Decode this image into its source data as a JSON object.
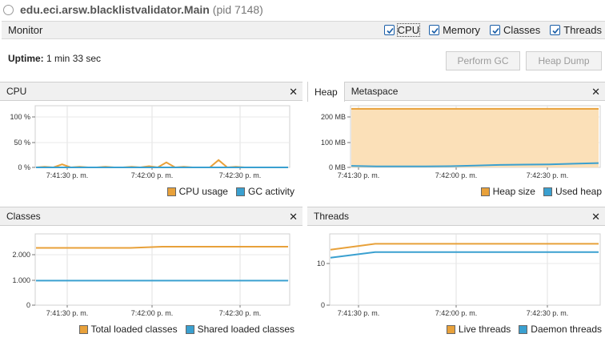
{
  "window": {
    "app_name": "edu.eci.arsw.blacklistvalidator.Main",
    "pid": "(pid 7148)"
  },
  "monitor": {
    "label": "Monitor",
    "checkboxes": [
      {
        "label": "CPU",
        "checked": true
      },
      {
        "label": "Memory",
        "checked": true
      },
      {
        "label": "Classes",
        "checked": true
      },
      {
        "label": "Threads",
        "checked": true
      }
    ]
  },
  "uptime": {
    "label": "Uptime:",
    "value": "1 min 33 sec"
  },
  "buttons": {
    "perform_gc": "Perform GC",
    "heap_dump": "Heap Dump"
  },
  "colors": {
    "orange": "#e8a13a",
    "blue": "#3aa0d0"
  },
  "x_ticks": [
    "7:41:30 p. m.",
    "7:42:00 p. m.",
    "7:42:30 p. m."
  ],
  "cpu": {
    "title": "CPU",
    "y_ticks": [
      "100 %",
      "50 %",
      "0 %"
    ],
    "legend": [
      "CPU usage",
      "GC activity"
    ],
    "chart_data": {
      "type": "line",
      "ylim": [
        0,
        100
      ],
      "series": [
        {
          "name": "CPU usage",
          "values": [
            0,
            1,
            0,
            5,
            0,
            1,
            0,
            0,
            1,
            0,
            0,
            1,
            0,
            2,
            0,
            8,
            0,
            1,
            0,
            0,
            0,
            12,
            0,
            1,
            0,
            0,
            0,
            0,
            0,
            0
          ]
        },
        {
          "name": "GC activity",
          "values": [
            0,
            0,
            0,
            0,
            0,
            0,
            0,
            0,
            0,
            0
          ]
        }
      ]
    }
  },
  "heap": {
    "tabs": [
      "Heap",
      "Metaspace"
    ],
    "y_ticks": [
      "200 MB",
      "100 MB",
      "0 MB"
    ],
    "legend": [
      "Heap size",
      "Used heap"
    ],
    "chart_data": {
      "type": "area",
      "ylim": [
        0,
        200
      ],
      "series": [
        {
          "name": "Heap size",
          "values": [
            190,
            190,
            190,
            190,
            190,
            190,
            190,
            190,
            190,
            190,
            190
          ]
        },
        {
          "name": "Used heap",
          "values": [
            5,
            3,
            3,
            3,
            4,
            6,
            8,
            9,
            10,
            12,
            14
          ]
        }
      ]
    }
  },
  "classes": {
    "title": "Classes",
    "y_ticks": [
      "2.000",
      "1.000",
      "0"
    ],
    "legend": [
      "Total loaded classes",
      "Shared loaded classes"
    ],
    "chart_data": {
      "type": "line",
      "ylim": [
        0,
        3000
      ],
      "series": [
        {
          "name": "Total loaded classes",
          "values": [
            2410,
            2410,
            2410,
            2410,
            2460,
            2460,
            2460,
            2460,
            2460
          ]
        },
        {
          "name": "Shared loaded classes",
          "values": [
            1030,
            1030,
            1030,
            1030,
            1030,
            1030,
            1030,
            1030,
            1030
          ]
        }
      ]
    }
  },
  "threads": {
    "title": "Threads",
    "y_ticks": [
      "10",
      "0"
    ],
    "legend": [
      "Live threads",
      "Daemon threads"
    ],
    "chart_data": {
      "type": "line",
      "ylim": [
        0,
        18
      ],
      "series": [
        {
          "name": "Live threads",
          "values": [
            14,
            15.5,
            15.5,
            15.5,
            15.5,
            15.5,
            15.5
          ]
        },
        {
          "name": "Daemon threads",
          "values": [
            12,
            13.4,
            13.4,
            13.4,
            13.4,
            13.4,
            13.4
          ]
        }
      ]
    }
  }
}
